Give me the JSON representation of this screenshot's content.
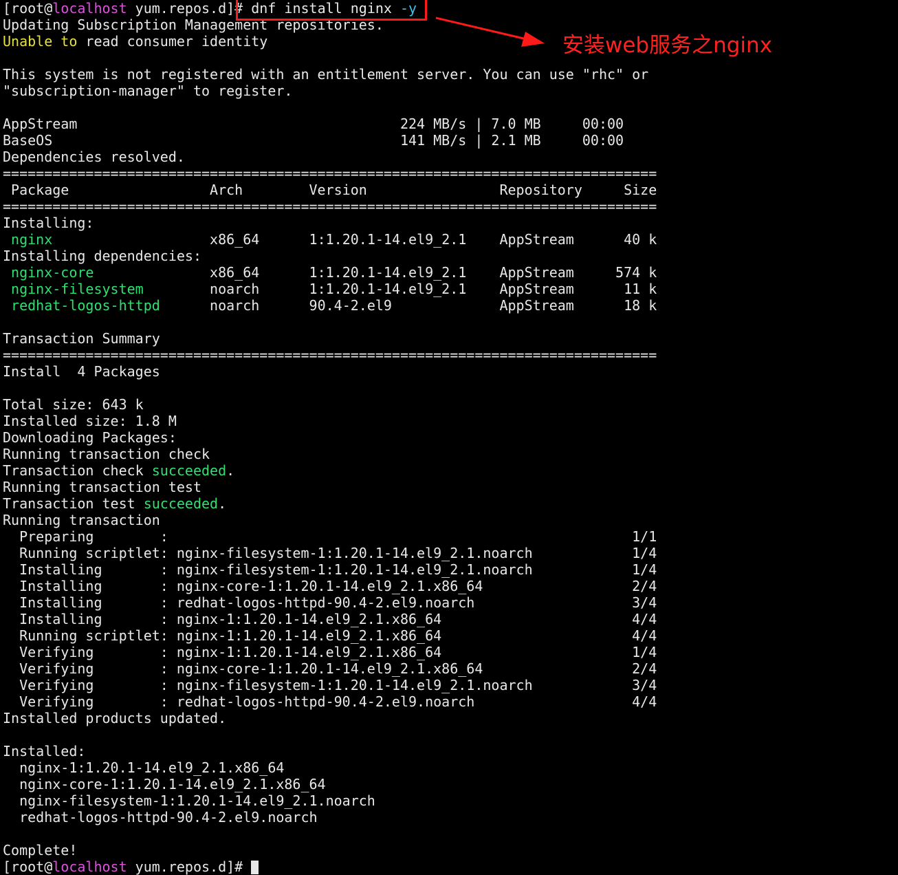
{
  "annotation": {
    "label": "安装web服务之nginx",
    "color": "#ff2020"
  },
  "colors": {
    "default": "#e8e8e8",
    "hostname": "#e050e0",
    "flag": "#40c0f0",
    "warning": "#e8e040",
    "success": "#30e070",
    "package": "#30e070",
    "annotation": "#ff2020"
  },
  "terminal": {
    "lines": [
      [
        {
          "t": "[root@",
          "c": "default"
        },
        {
          "t": "localhost",
          "c": "hostname"
        },
        {
          "t": " yum.repos.d]# dnf install nginx ",
          "c": "default"
        },
        {
          "t": "-y",
          "c": "flag"
        }
      ],
      [
        {
          "t": "Updating Subscription Management repositories.",
          "c": "default"
        }
      ],
      [
        {
          "t": "Unable to",
          "c": "warning"
        },
        {
          "t": " read consumer identity",
          "c": "default"
        }
      ],
      [],
      [
        {
          "t": "This system is not registered with an entitlement server. You can use \"rhc\" or",
          "c": "default"
        }
      ],
      [
        {
          "t": "\"subscription-manager\" to register.",
          "c": "default"
        }
      ],
      [],
      [
        {
          "t": "AppStream                                       224 MB/s | 7.0 MB     00:00",
          "c": "default"
        }
      ],
      [
        {
          "t": "BaseOS                                          141 MB/s | 2.1 MB     00:00",
          "c": "default"
        }
      ],
      [
        {
          "t": "Dependencies resolved.",
          "c": "default"
        }
      ],
      [
        {
          "t": "===============================================================================",
          "c": "default"
        }
      ],
      [
        {
          "t": " Package                 Arch        Version                Repository     Size",
          "c": "default"
        }
      ],
      [
        {
          "t": "===============================================================================",
          "c": "default"
        }
      ],
      [
        {
          "t": "Installing:",
          "c": "default"
        }
      ],
      [
        {
          "t": " ",
          "c": "default"
        },
        {
          "t": "nginx",
          "c": "package"
        },
        {
          "t": "                   x86_64      1:1.20.1-14.el9_2.1    AppStream      40 k",
          "c": "default"
        }
      ],
      [
        {
          "t": "Installing dependencies:",
          "c": "default"
        }
      ],
      [
        {
          "t": " ",
          "c": "default"
        },
        {
          "t": "nginx-core",
          "c": "package"
        },
        {
          "t": "              x86_64      1:1.20.1-14.el9_2.1    AppStream     574 k",
          "c": "default"
        }
      ],
      [
        {
          "t": " ",
          "c": "default"
        },
        {
          "t": "nginx-filesystem",
          "c": "package"
        },
        {
          "t": "        noarch      1:1.20.1-14.el9_2.1    AppStream      11 k",
          "c": "default"
        }
      ],
      [
        {
          "t": " ",
          "c": "default"
        },
        {
          "t": "redhat-logos-httpd",
          "c": "package"
        },
        {
          "t": "      noarch      90.4-2.el9             AppStream      18 k",
          "c": "default"
        }
      ],
      [],
      [
        {
          "t": "Transaction Summary",
          "c": "default"
        }
      ],
      [
        {
          "t": "===============================================================================",
          "c": "default"
        }
      ],
      [
        {
          "t": "Install  4 Packages",
          "c": "default"
        }
      ],
      [],
      [
        {
          "t": "Total size: 643 k",
          "c": "default"
        }
      ],
      [
        {
          "t": "Installed size: 1.8 M",
          "c": "default"
        }
      ],
      [
        {
          "t": "Downloading Packages:",
          "c": "default"
        }
      ],
      [
        {
          "t": "Running transaction check",
          "c": "default"
        }
      ],
      [
        {
          "t": "Transaction check ",
          "c": "default"
        },
        {
          "t": "succeeded",
          "c": "success"
        },
        {
          "t": ".",
          "c": "default"
        }
      ],
      [
        {
          "t": "Running transaction test",
          "c": "default"
        }
      ],
      [
        {
          "t": "Transaction test ",
          "c": "default"
        },
        {
          "t": "succeeded",
          "c": "success"
        },
        {
          "t": ".",
          "c": "default"
        }
      ],
      [
        {
          "t": "Running transaction",
          "c": "default"
        }
      ],
      [
        {
          "t": "  Preparing        :                                                        1/1",
          "c": "default"
        }
      ],
      [
        {
          "t": "  Running scriptlet: nginx-filesystem-1:1.20.1-14.el9_2.1.noarch            1/4",
          "c": "default"
        }
      ],
      [
        {
          "t": "  Installing       : nginx-filesystem-1:1.20.1-14.el9_2.1.noarch            1/4",
          "c": "default"
        }
      ],
      [
        {
          "t": "  Installing       : nginx-core-1:1.20.1-14.el9_2.1.x86_64                  2/4",
          "c": "default"
        }
      ],
      [
        {
          "t": "  Installing       : redhat-logos-httpd-90.4-2.el9.noarch                   3/4",
          "c": "default"
        }
      ],
      [
        {
          "t": "  Installing       : nginx-1:1.20.1-14.el9_2.1.x86_64                       4/4",
          "c": "default"
        }
      ],
      [
        {
          "t": "  Running scriptlet: nginx-1:1.20.1-14.el9_2.1.x86_64                       4/4",
          "c": "default"
        }
      ],
      [
        {
          "t": "  Verifying        : nginx-1:1.20.1-14.el9_2.1.x86_64                       1/4",
          "c": "default"
        }
      ],
      [
        {
          "t": "  Verifying        : nginx-core-1:1.20.1-14.el9_2.1.x86_64                  2/4",
          "c": "default"
        }
      ],
      [
        {
          "t": "  Verifying        : nginx-filesystem-1:1.20.1-14.el9_2.1.noarch            3/4",
          "c": "default"
        }
      ],
      [
        {
          "t": "  Verifying        : redhat-logos-httpd-90.4-2.el9.noarch                   4/4",
          "c": "default"
        }
      ],
      [
        {
          "t": "Installed products updated.",
          "c": "default"
        }
      ],
      [],
      [
        {
          "t": "Installed:",
          "c": "default"
        }
      ],
      [
        {
          "t": "  nginx-1:1.20.1-14.el9_2.1.x86_64",
          "c": "default"
        }
      ],
      [
        {
          "t": "  nginx-core-1:1.20.1-14.el9_2.1.x86_64",
          "c": "default"
        }
      ],
      [
        {
          "t": "  nginx-filesystem-1:1.20.1-14.el9_2.1.noarch",
          "c": "default"
        }
      ],
      [
        {
          "t": "  redhat-logos-httpd-90.4-2.el9.noarch",
          "c": "default"
        }
      ],
      [],
      [
        {
          "t": "Complete!",
          "c": "default"
        }
      ],
      [
        {
          "t": "[root@",
          "c": "default"
        },
        {
          "t": "localhost",
          "c": "hostname"
        },
        {
          "t": " yum.repos.d]# ",
          "c": "default"
        }
      ]
    ]
  }
}
